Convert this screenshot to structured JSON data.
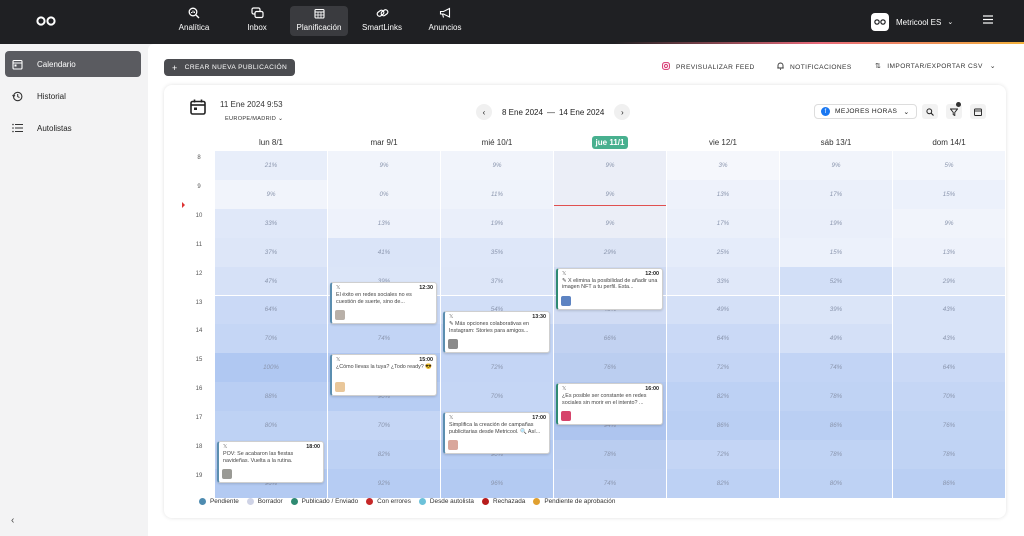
{
  "topbar": {
    "nav": [
      {
        "label": "Analítica",
        "icon": "analytics-icon"
      },
      {
        "label": "Inbox",
        "icon": "inbox-icon"
      },
      {
        "label": "Planificación",
        "icon": "calendar-icon"
      },
      {
        "label": "SmartLinks",
        "icon": "link-icon"
      },
      {
        "label": "Anuncios",
        "icon": "megaphone-icon"
      }
    ],
    "active_nav": "Planificación",
    "account": "Metricool ES"
  },
  "sidebar": {
    "items": [
      {
        "label": "Calendario",
        "icon": "calendar-icon"
      },
      {
        "label": "Historial",
        "icon": "history-icon"
      },
      {
        "label": "Autolistas",
        "icon": "list-icon"
      }
    ]
  },
  "toolbar": {
    "new_post": "CREAR NUEVA PUBLICACIÓN",
    "preview_feed": "PREVISUALIZAR FEED",
    "notifications": "NOTIFICACIONES",
    "import_export": "IMPORTAR/EXPORTAR CSV"
  },
  "calendar": {
    "current_datetime": "11 Ene 2024 9:53",
    "timezone": "EUROPE/MADRID",
    "range_start": "8 Ene 2024",
    "range_sep": "—",
    "range_end": "14 Ene 2024",
    "best_hours": "MEJORES HORAS",
    "days": [
      "lun 8/1",
      "mar 9/1",
      "mié 10/1",
      "jue 11/1",
      "vie 12/1",
      "sáb 13/1",
      "dom 14/1"
    ],
    "today_index": 3,
    "hours": [
      "8",
      "9",
      "10",
      "11",
      "12",
      "13",
      "14",
      "15",
      "16",
      "17",
      "18",
      "19"
    ],
    "heat": [
      [
        "21%",
        "9%",
        "9%",
        "9%",
        "3%",
        "9%",
        "5%"
      ],
      [
        "9%",
        "0%",
        "11%",
        "9%",
        "13%",
        "17%",
        "15%"
      ],
      [
        "33%",
        "13%",
        "19%",
        "9%",
        "17%",
        "19%",
        "9%"
      ],
      [
        "37%",
        "41%",
        "35%",
        "29%",
        "25%",
        "15%",
        "13%"
      ],
      [
        "47%",
        "39%",
        "37%",
        "",
        "33%",
        "52%",
        "29%"
      ],
      [
        "64%",
        "",
        "54%",
        "45%",
        "49%",
        "39%",
        "43%"
      ],
      [
        "70%",
        "74%",
        "",
        "66%",
        "64%",
        "49%",
        "43%"
      ],
      [
        "100%",
        "",
        "72%",
        "76%",
        "72%",
        "74%",
        "64%"
      ],
      [
        "88%",
        "90%",
        "70%",
        "",
        "82%",
        "78%",
        "70%"
      ],
      [
        "80%",
        "70%",
        "",
        "94%",
        "86%",
        "86%",
        "76%"
      ],
      [
        "",
        "82%",
        "90%",
        "78%",
        "72%",
        "78%",
        "78%"
      ],
      [
        "96%",
        "92%",
        "96%",
        "74%",
        "82%",
        "80%",
        "86%"
      ]
    ],
    "posts": [
      {
        "day": 1,
        "time": "12:30",
        "text": "El éxito en redes sociales no es cuestión de suerte, sino de...",
        "status": "pend",
        "thumb": "#b8b0a8"
      },
      {
        "day": 1,
        "time": "15:00",
        "text": "¿Cómo llevas la tuya? ¿Todo ready? 😎",
        "status": "pend",
        "thumb": "#e9c79a"
      },
      {
        "day": 2,
        "time": "13:30",
        "text": "✎ Más opciones colaborativas en Instagram: Stories para amigos...",
        "status": "pend",
        "thumb": "#8a8a8a"
      },
      {
        "day": 2,
        "time": "17:00",
        "text": "Simplifica la creación de campañas publicitarias desde Metricool. 🔍 Así...",
        "status": "pend",
        "thumb": "#d9a79c"
      },
      {
        "day": 3,
        "time": "12:00",
        "text": "✎ X elimina la posibilidad de añadir una imagen NFT a tu perfil. Esta...",
        "status": "pub",
        "thumb": "#5d83c2"
      },
      {
        "day": 3,
        "time": "16:00",
        "text": "¿Es posible ser constante en redes sociales sin morir en el intento? ...",
        "status": "pub",
        "thumb": "#d6446b"
      },
      {
        "day": 0,
        "time": "18:00",
        "text": "POV: Se acabaron las fiestas navideñas. Vuelta a la rutina.",
        "status": "pend",
        "thumb": "#9a9a95"
      }
    ]
  },
  "legend": [
    {
      "label": "Pendiente",
      "color": "#4e8bb0"
    },
    {
      "label": "Borrador",
      "color": "#cfd3e6"
    },
    {
      "label": "Publicado / Enviado",
      "color": "#2f8a72"
    },
    {
      "label": "Con errores",
      "color": "#c62828"
    },
    {
      "label": "Desde autolista",
      "color": "#6cc1d9"
    },
    {
      "label": "Rechazada",
      "color": "#b71c1c"
    },
    {
      "label": "Pendiente de aprobación",
      "color": "#e0a030"
    }
  ]
}
